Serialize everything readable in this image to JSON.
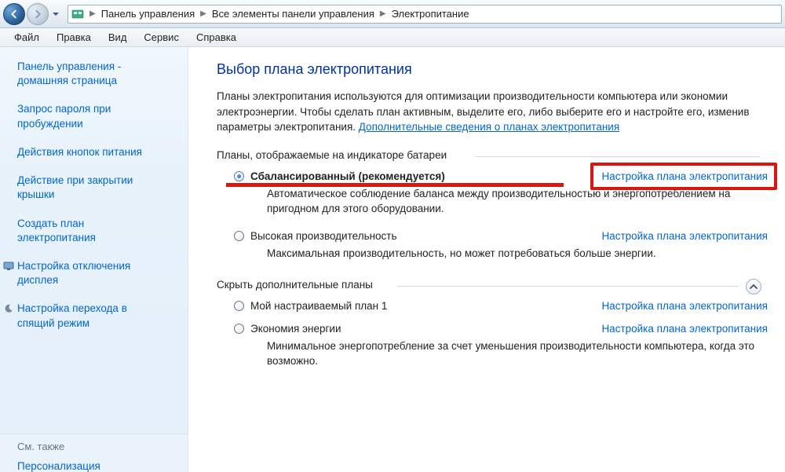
{
  "breadcrumbs": {
    "b1": "Панель управления",
    "b2": "Все элементы панели управления",
    "b3": "Электропитание"
  },
  "menu": {
    "file": "Файл",
    "edit": "Правка",
    "view": "Вид",
    "service": "Сервис",
    "help": "Справка"
  },
  "sidebar": {
    "home1": "Панель управления -",
    "home2": "домашняя страница",
    "l1a": "Запрос пароля при",
    "l1b": "пробуждении",
    "l2": "Действия кнопок питания",
    "l3a": "Действие при закрытии",
    "l3b": "крышки",
    "l4a": "Создать план",
    "l4b": "электропитания",
    "l5a": "Настройка отключения",
    "l5b": "дисплея",
    "l6a": "Настройка перехода в",
    "l6b": "спящий режим",
    "seeAlso": "См. также",
    "personalization": "Персонализация"
  },
  "content": {
    "title": "Выбор плана электропитания",
    "intro": "Планы электропитания используются для оптимизации производительности компьютера или экономии электроэнергии. Чтобы сделать план активным, выделите его, либо выберите его и настройте его, изменив параметры электропитания. ",
    "introLink": "Дополнительные сведения о планах электропитания",
    "group1": "Планы, отображаемые на индикаторе батареи",
    "group2": "Скрыть дополнительные планы",
    "configure": "Настройка плана электропитания",
    "plan1": {
      "name": "Сбалансированный (рекомендуется)",
      "desc": "Автоматическое соблюдение баланса между производительностью и энергопотреблением на пригодном для этого оборудовании."
    },
    "plan2": {
      "name": "Высокая производительность",
      "desc": "Максимальная производительность, но может потребоваться больше энергии."
    },
    "plan3": {
      "name": "Мой настраиваемый план 1"
    },
    "plan4": {
      "name": "Экономия энергии",
      "desc": "Минимальное энергопотребление за счет уменьшения производительности компьютера, когда это возможно."
    }
  }
}
